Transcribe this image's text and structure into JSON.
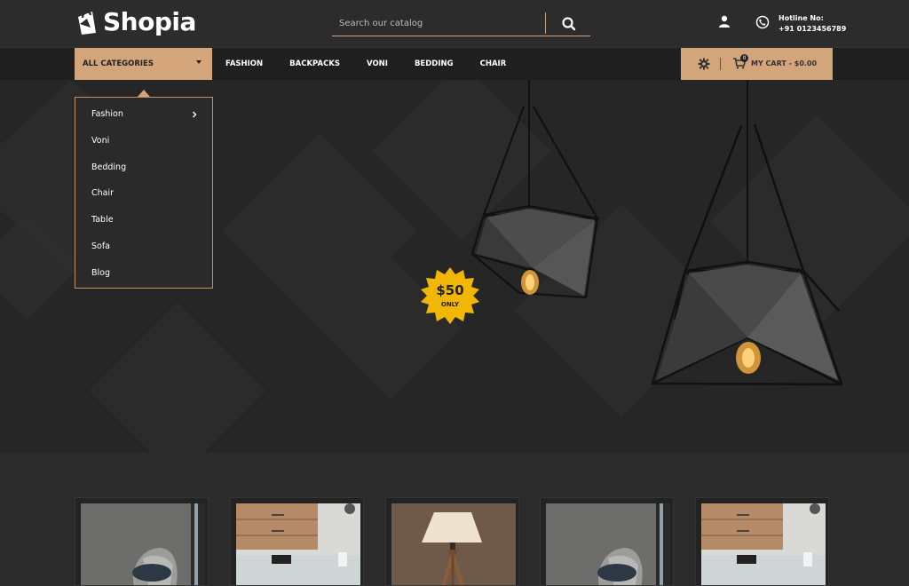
{
  "header": {
    "logo_text": "Shopia",
    "search_placeholder": "Search our catalog",
    "hotline_label": "Hotline No:",
    "hotline_number": "+91 0123456789"
  },
  "nav": {
    "all_categories": "ALL CATEGORIES",
    "links": [
      "FASHION",
      "BACKPACKS",
      "VONI",
      "BEDDING",
      "CHAIR"
    ],
    "cart_label": "MY CART - $0.00",
    "cart_count": "0"
  },
  "dropdown": {
    "items": [
      "Fashion",
      "Voni",
      "Bedding",
      "Chair",
      "Table",
      "Sofa",
      "Blog"
    ]
  },
  "hero": {
    "price": "$50",
    "price_note": "ONLY"
  },
  "colors": {
    "accent": "#d4a47a",
    "background": "#2a2a2a",
    "nav_bg": "#1f1f1f",
    "badge": "#f2b705"
  },
  "icons": {
    "search": "search-icon",
    "user": "user-icon",
    "hotline": "phone-icon",
    "settings": "gear-icon",
    "cart": "cart-icon"
  }
}
